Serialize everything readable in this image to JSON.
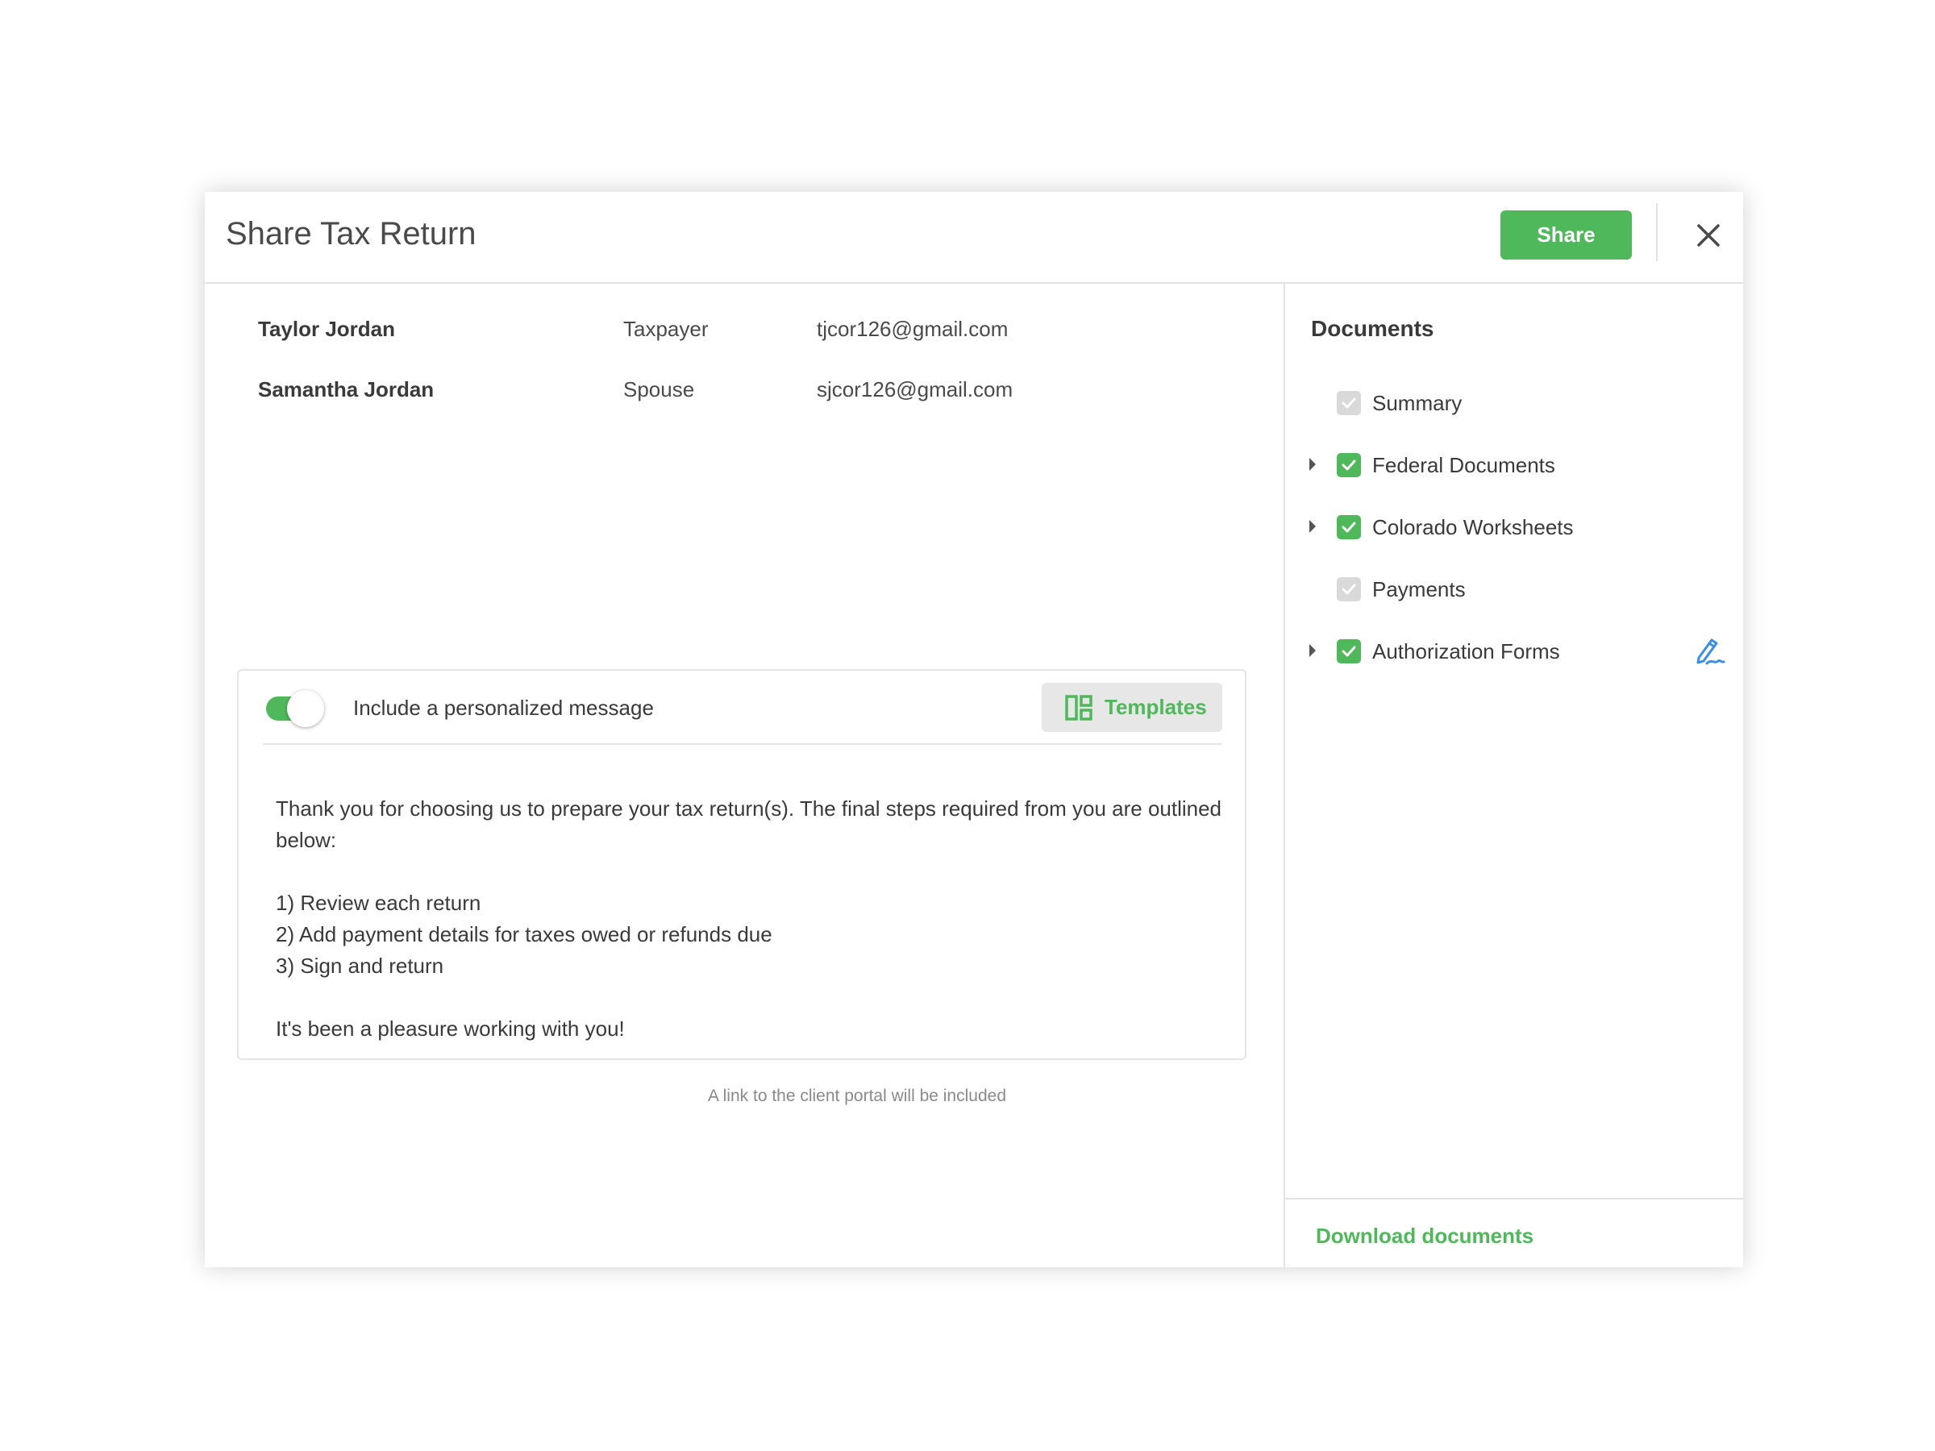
{
  "modal": {
    "title": "Share Tax Return",
    "share_label": "Share"
  },
  "recipients": [
    {
      "name": "Taylor Jordan",
      "role": "Taxpayer",
      "email": "tjcor126@gmail.com"
    },
    {
      "name": "Samantha Jordan",
      "role": "Spouse",
      "email": "sjcor126@gmail.com"
    }
  ],
  "message": {
    "toggle_on": true,
    "toggle_label": "Include a personalized message",
    "templates_label": "Templates",
    "intro": "Thank you for choosing us to prepare your tax return(s). The final steps required from you are outlined below:",
    "steps": [
      "1) Review each return",
      "2) Add payment details for taxes owed or refunds due",
      "3) Sign and return"
    ],
    "closing": "It's been a pleasure working with you!",
    "portal_note": "A link to the client portal will be included"
  },
  "documents": {
    "title": "Documents",
    "items": [
      {
        "label": "Summary",
        "checked": true,
        "state": "disabled",
        "expandable": false
      },
      {
        "label": "Federal Documents",
        "checked": true,
        "state": "active",
        "expandable": true
      },
      {
        "label": "Colorado Worksheets",
        "checked": true,
        "state": "active",
        "expandable": true
      },
      {
        "label": "Payments",
        "checked": true,
        "state": "disabled",
        "expandable": false
      },
      {
        "label": "Authorization Forms",
        "checked": true,
        "state": "active",
        "expandable": true,
        "sign_icon": "signature-pen-icon"
      }
    ],
    "download_label": "Download documents"
  },
  "colors": {
    "accent_green": "#4fb85a",
    "sign_icon_blue": "#3b8ee8",
    "disabled_check": "#d9d9d9",
    "border": "#e2e2e2"
  }
}
